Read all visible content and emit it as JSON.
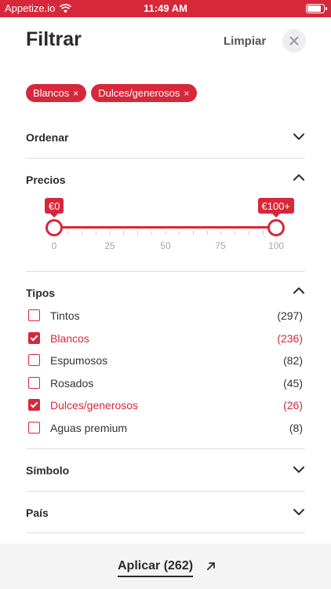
{
  "status_bar": {
    "carrier": "Appetize.io",
    "time": "11:49 AM",
    "battery_level": 0.9
  },
  "header": {
    "title": "Filtrar",
    "clear_label": "Limpiar",
    "close_icon": "close-icon"
  },
  "active_filters": [
    {
      "label": "Blancos",
      "remove": "×"
    },
    {
      "label": "Dulces/generosos",
      "remove": "×"
    }
  ],
  "sections": {
    "order": {
      "label": "Ordenar",
      "expanded": false
    },
    "prices": {
      "label": "Precios",
      "expanded": true
    },
    "types": {
      "label": "Tipos",
      "expanded": true
    },
    "symbol": {
      "label": "Símbolo",
      "expanded": false
    },
    "country": {
      "label": "País",
      "expanded": false
    }
  },
  "price_slider": {
    "min_label": "€0",
    "max_label": "€100+",
    "min_value": 0,
    "max_value": 100,
    "range_min": 0,
    "range_max": 100,
    "ticks": [
      "0",
      "25",
      "50",
      "75",
      "100"
    ]
  },
  "types": [
    {
      "name": "Tintos",
      "count": "(297)",
      "checked": false
    },
    {
      "name": "Blancos",
      "count": "(236)",
      "checked": true
    },
    {
      "name": "Espumosos",
      "count": "(82)",
      "checked": false
    },
    {
      "name": "Rosados",
      "count": "(45)",
      "checked": false
    },
    {
      "name": "Dulces/generosos",
      "count": "(26)",
      "checked": true
    },
    {
      "name": "Aguas premium",
      "count": "(8)",
      "checked": false
    }
  ],
  "footer": {
    "apply_label": "Aplicar (262)"
  },
  "colors": {
    "accent": "#d6283a",
    "text": "#2b2b2b",
    "divider": "#dedede",
    "footer_bg": "#f4f4f4"
  }
}
